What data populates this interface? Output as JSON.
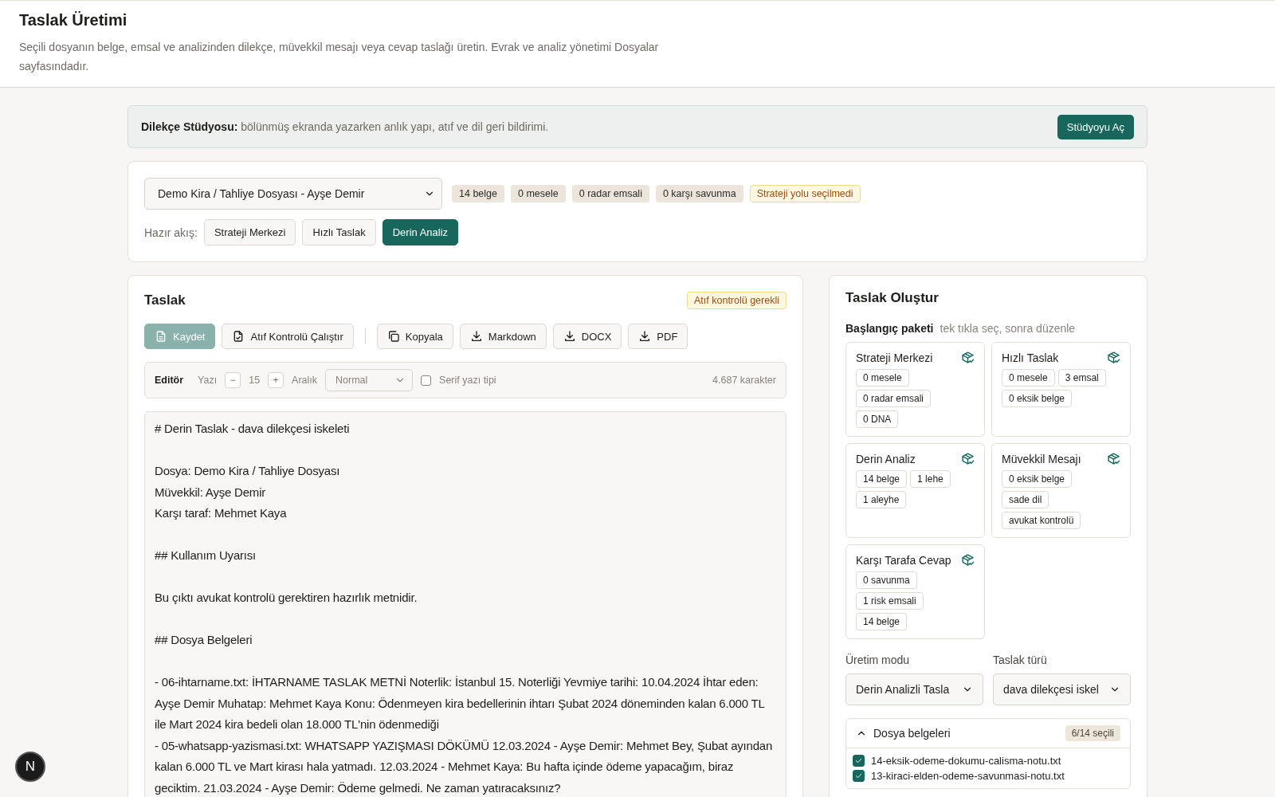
{
  "header": {
    "title": "Taslak Üretimi",
    "subtitle": "Seçili dosyanın belge, emsal ve analizinden dilekçe, müvekkil mesajı veya cevap taslağı üretin. Evrak ve analiz yönetimi Dosyalar sayfasındadır."
  },
  "banner": {
    "text": "**Dilekçe Stüdyosu:** bölünmüş ekranda yazarken anlık yapı, atıf ve dil geri bildirimi.",
    "button": "Stüdyoyu Aç"
  },
  "case": {
    "select": "Demo Kira / Tahliye Dosyası - Ayşe Demir",
    "chips": [
      {
        "label": "14 belge",
        "kind": "neutral"
      },
      {
        "label": "0 mesele",
        "kind": "neutral"
      },
      {
        "label": "0 radar emsali",
        "kind": "neutral"
      },
      {
        "label": "0 karşı savunma",
        "kind": "neutral"
      },
      {
        "label": "Strateji yolu seçilmedi",
        "kind": "warning"
      }
    ],
    "flow_label": "Hazır akış:",
    "flows": [
      {
        "label": "Strateji Merkezi",
        "selected": false
      },
      {
        "label": "Hızlı Taslak",
        "selected": false
      },
      {
        "label": "Derin Analiz",
        "selected": true
      }
    ]
  },
  "draft": {
    "title": "Taslak",
    "badge": "Atıf kontrolü gerekli",
    "toolbar": [
      {
        "label": "Kaydet",
        "kind": "primary",
        "disabled": true
      },
      {
        "label": "Atıf Kontrolü Çalıştır",
        "kind": "secondary",
        "disabled": false
      },
      {
        "kind": "divider"
      },
      {
        "label": "Kopyala",
        "kind": "secondary",
        "disabled": false
      },
      {
        "label": "Markdown",
        "kind": "secondary",
        "disabled": false
      },
      {
        "label": "DOCX",
        "kind": "secondary",
        "disabled": false
      },
      {
        "label": "PDF",
        "kind": "secondary",
        "disabled": false
      }
    ],
    "editor_bar": {
      "label": "Editör",
      "size_label": "Yazı",
      "minus": "−",
      "size": "15",
      "plus": "+",
      "spacing_label": "Aralık",
      "spacing": "Normal",
      "serif_label": "Serif yazı tipi",
      "serif_checked": false,
      "count": "4.687 karakter"
    },
    "paragraphs": [
      [
        "# Derin Taslak - dava dilekçesi iskeleti"
      ],
      [
        "Dosya: Demo Kira / Tahliye Dosyası",
        "Müvekkil: Ayşe Demir",
        "Karşı taraf: Mehmet Kaya"
      ],
      [
        "## Kullanım Uyarısı"
      ],
      [
        "Bu çıktı avukat kontrolü gerektiren hazırlık metnidir."
      ],
      [
        "## Dosya Belgeleri"
      ],
      [
        "- 06-ihtarname.txt: İHTARNAME TASLAK METNİ Noterlik: İstanbul 15. Noterliği Yevmiye tarihi: 10.04.2024 İhtar eden: Ayşe Demir Muhatap: Mehmet Kaya Konu: Ödenmeyen kira bedellerinin ihtarı Şubat 2024 döneminden kalan 6.000 TL ile Mart 2024 kira bedeli olan 18.000 TL'nin ödenmediği",
        "- 05-whatsapp-yazismasi.txt: WHATSAPP YAZIŞMASI DÖKÜMÜ 12.03.2024 - Ayşe Demir: Mehmet Bey, Şubat ayından kalan 6.000 TL ve Mart kirası hala yatmadı. 12.03.2024 - Mehmet Kaya: Bu hafta içinde ödeme yapacağım, biraz geciktim. 21.03.2024 - Ayşe Demir: Ödeme gelmedi. Ne zaman yatıracaksınız?"
      ]
    ]
  },
  "create": {
    "title": "Taslak Oluştur",
    "packs_label": "Başlangıç paketi",
    "packs_hint": "tek tıkla seç, sonra düzenle",
    "packs": [
      {
        "title": "Strateji Merkezi",
        "chips": [
          "0 mesele",
          "0 radar emsali",
          "0 DNA"
        ]
      },
      {
        "title": "Hızlı Taslak",
        "chips": [
          "0 mesele",
          "3 emsal",
          "0 eksik belge"
        ]
      },
      {
        "title": "Derin Analiz",
        "chips": [
          "14 belge",
          "1 lehe",
          "1 aleyhe"
        ]
      },
      {
        "title": "Müvekkil Mesajı",
        "chips": [
          "0 eksik belge",
          "sade dil",
          "avukat kontrolü"
        ]
      },
      {
        "title": "Karşı Tarafa Cevap",
        "chips": [
          "0 savunma",
          "1 risk emsali",
          "14 belge"
        ]
      }
    ],
    "fields": [
      {
        "label": "Üretim modu",
        "value": "Derin Analizli Tasla"
      },
      {
        "label": "Taslak türü",
        "value": "dava dilekçesi iskel"
      }
    ],
    "documents": {
      "title": "Dosya belgeleri",
      "expanded": true,
      "count": "6/14 seçili",
      "files": [
        {
          "name": "14-eksik-odeme-dokumu-calisma-notu.txt",
          "checked": true
        },
        {
          "name": "13-kiraci-elden-odeme-savunmasi-notu.txt",
          "checked": true
        }
      ]
    }
  },
  "dev_badge": "N"
}
